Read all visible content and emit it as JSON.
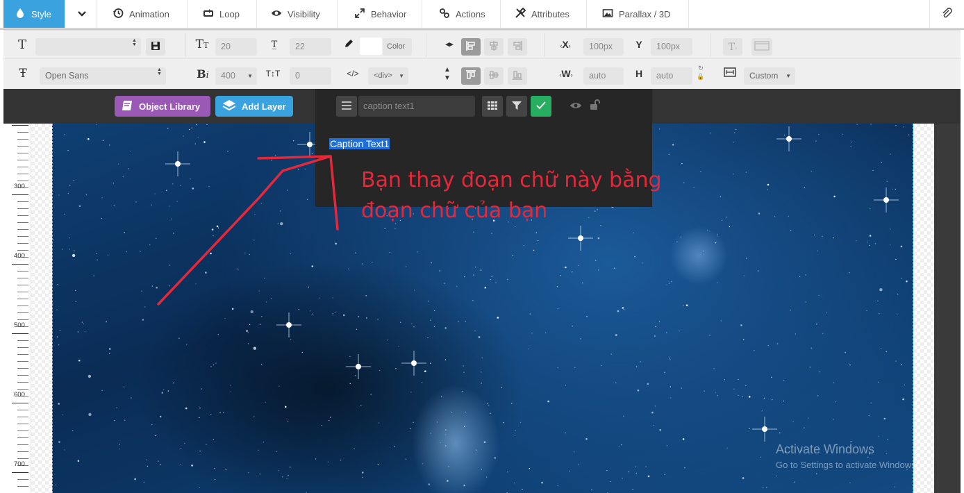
{
  "tabs": [
    {
      "label": "Style",
      "icon": "drop-icon",
      "active": true
    },
    {
      "label": "Animation",
      "icon": "history-icon"
    },
    {
      "label": "Loop",
      "icon": "loop-icon"
    },
    {
      "label": "Visibility",
      "icon": "eye-icon"
    },
    {
      "label": "Behavior",
      "icon": "expand-icon"
    },
    {
      "label": "Actions",
      "icon": "link-icon"
    },
    {
      "label": "Attributes",
      "icon": "tools-icon"
    },
    {
      "label": "Parallax / 3D",
      "icon": "image-icon"
    }
  ],
  "toolbar": {
    "font_size": "20",
    "line_height": "22",
    "color_label": "Color",
    "x_value": "100px",
    "y_value": "100px",
    "font_family": "Open Sans",
    "font_weight": "400",
    "letter_spacing": "0",
    "tag": "<div>",
    "width_value": "auto",
    "height_value": "auto",
    "size_mode": "Custom",
    "x_label": "X",
    "y_label": "Y",
    "w_label": "W",
    "h_label": "H"
  },
  "layerbar": {
    "object_library_label": "Object Library",
    "add_layer_label": "Add Layer",
    "layer_name": "caption text1"
  },
  "canvas": {
    "caption_text": "Caption Text1",
    "note_line1": "Bạn thay đoạn chữ này bằng",
    "note_line2": "đoạn chữ của bạn",
    "ruler_labels": [
      "300",
      "400",
      "500",
      "600",
      "700"
    ],
    "watermark_title": "Activate Windows",
    "watermark_sub": "Go to Settings to activate Windows."
  },
  "colors": {
    "accent_blue": "#3ba2e0",
    "library_purple": "#9b59b6",
    "confirm_green": "#27ae60",
    "annotation_red": "#e5283a"
  }
}
